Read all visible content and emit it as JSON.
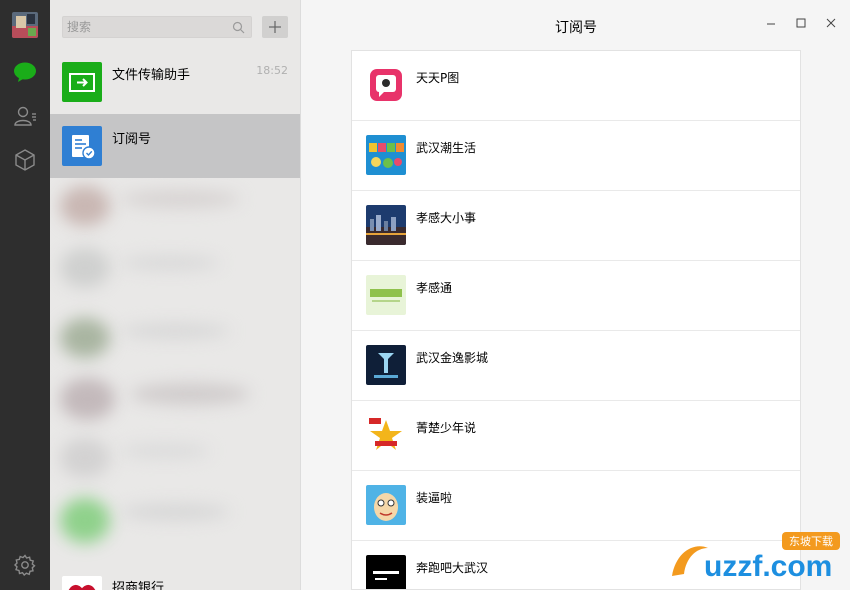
{
  "sidebar": {
    "icons": [
      "avatar-image",
      "chat-icon",
      "contacts-icon",
      "favorites-icon",
      "settings-icon"
    ],
    "accent_color": "#1aad19"
  },
  "search": {
    "placeholder": "搜索",
    "add_label": "+"
  },
  "chats": [
    {
      "name": "文件传输助手",
      "time": "18:52"
    },
    {
      "name": "订阅号",
      "time": ""
    }
  ],
  "last_chat": {
    "name": "招商银行"
  },
  "main": {
    "title": "订阅号",
    "accounts": [
      {
        "name": "天天P图"
      },
      {
        "name": "武汉潮生活"
      },
      {
        "name": "孝感大小事"
      },
      {
        "name": "孝感通"
      },
      {
        "name": "武汉金逸影城"
      },
      {
        "name": "菁楚少年说"
      },
      {
        "name": "装逼啦"
      },
      {
        "name": "奔跑吧大武汉"
      }
    ]
  },
  "watermark": {
    "text": "uzzf.com",
    "tag": "东坡下载"
  }
}
